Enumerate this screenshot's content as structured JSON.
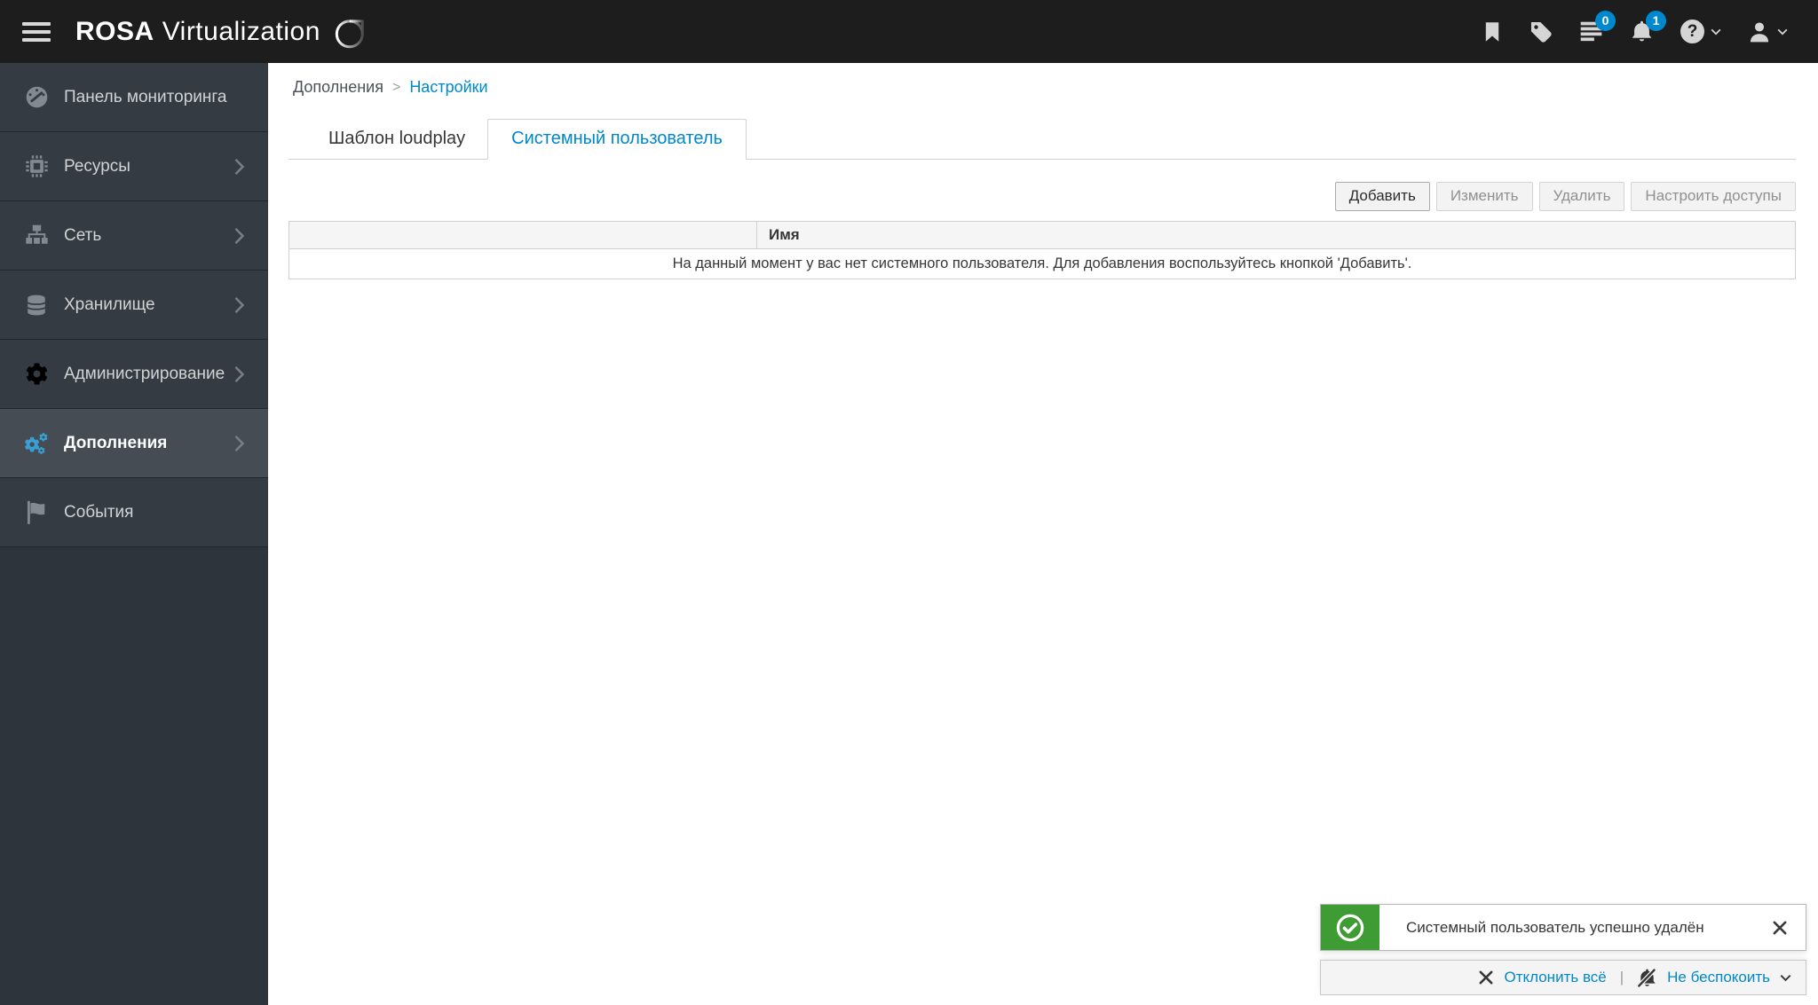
{
  "header": {
    "brand": {
      "bold": "ROSA",
      "rest": "Virtualization"
    },
    "badges": {
      "tasks": "0",
      "alerts": "1"
    },
    "help_glyph": "?"
  },
  "sidebar": {
    "items": [
      {
        "label": "Панель мониторинга",
        "icon": "dashboard-icon",
        "expandable": false,
        "active": false
      },
      {
        "label": "Ресурсы",
        "icon": "compute-icon",
        "expandable": true,
        "active": false
      },
      {
        "label": "Сеть",
        "icon": "network-icon",
        "expandable": true,
        "active": false
      },
      {
        "label": "Хранилище",
        "icon": "storage-icon",
        "expandable": true,
        "active": false
      },
      {
        "label": "Администрирование",
        "icon": "administration-icon",
        "expandable": true,
        "active": false
      },
      {
        "label": "Дополнения",
        "icon": "addons-icon",
        "expandable": true,
        "active": true
      },
      {
        "label": "События",
        "icon": "events-icon",
        "expandable": false,
        "active": false
      }
    ]
  },
  "breadcrumb": {
    "parent": "Дополнения",
    "separator": ">",
    "current": "Настройки"
  },
  "tabs": [
    {
      "label": "Шаблон loudplay",
      "active": false
    },
    {
      "label": "Системный пользователь",
      "active": true
    }
  ],
  "toolbar": {
    "add": "Добавить",
    "edit": "Изменить",
    "remove": "Удалить",
    "permissions": "Настроить доступы"
  },
  "table": {
    "name_column": "Имя",
    "empty_message": "На данный момент у вас нет системного пользователя. Для добавления воспользуйтесь кнопкой 'Добавить'."
  },
  "toast": {
    "type": "success",
    "message": "Системный пользователь успешно удалён"
  },
  "notifications": {
    "dismiss_all": "Отклонить всё",
    "separator": "|",
    "do_not_disturb": "Не беспокоить"
  },
  "colors": {
    "accent": "#0088ce",
    "success": "#3f9c35",
    "masthead_bg": "#1d1d1d",
    "sidebar_bg": "#353b42",
    "sidebar_active_bg": "#454c54",
    "addons_icon_blue": "#39a0d6"
  }
}
